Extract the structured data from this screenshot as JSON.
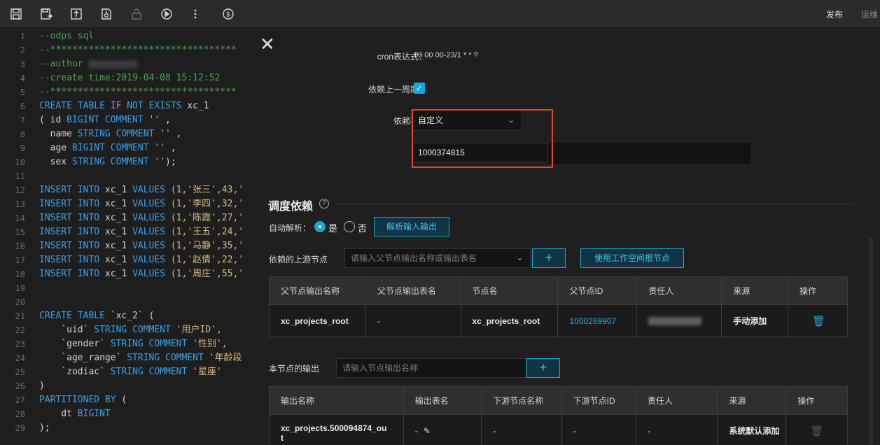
{
  "toolbar": {
    "icons": [
      "save-icon",
      "save-as-icon",
      "submit-icon",
      "schedule-icon",
      "lock-icon",
      "run-icon",
      "more-icon",
      "cost-icon"
    ],
    "publish_label": "发布",
    "ops_label": "运维"
  },
  "editor": {
    "lines": [
      {
        "n": "1"
      },
      {
        "n": "2"
      },
      {
        "n": "3"
      },
      {
        "n": "4"
      },
      {
        "n": "5"
      },
      {
        "n": "6"
      },
      {
        "n": "7"
      },
      {
        "n": "8"
      },
      {
        "n": "9"
      },
      {
        "n": "10"
      },
      {
        "n": "11"
      },
      {
        "n": "12"
      },
      {
        "n": "13"
      },
      {
        "n": "14"
      },
      {
        "n": "15"
      },
      {
        "n": "16"
      },
      {
        "n": "17"
      },
      {
        "n": "18"
      },
      {
        "n": "19"
      },
      {
        "n": "20"
      },
      {
        "n": "21"
      },
      {
        "n": "22"
      },
      {
        "n": "23"
      },
      {
        "n": "24"
      },
      {
        "n": "25"
      },
      {
        "n": "26"
      },
      {
        "n": "27"
      },
      {
        "n": "28"
      },
      {
        "n": "29"
      }
    ],
    "text": {
      "l1": "--odps sql",
      "l2": "--**********************************",
      "l3": "--author",
      "l4": "--create time:2019-04-08 15:12:52",
      "l5": "--**********************************",
      "l6a": "CREATE TABLE ",
      "l6b": "IF",
      "l6c": " NOT EXISTS",
      "l6d": " xc_1",
      "l7a": "( id ",
      "l7b": "BIGINT COMMENT",
      "l7c": " ''",
      "l7d": " ,",
      "l8a": "  name ",
      "l8b": "STRING COMMENT",
      "l8c": " ''",
      "l8d": " ,",
      "l9a": "  age ",
      "l9b": "BIGINT COMMENT",
      "l9c": " ''",
      "l9d": " ,",
      "l10a": "  sex ",
      "l10b": "STRING COMMENT",
      "l10c": " ''",
      "l10d": ");",
      "ins_kw": "INSERT INTO",
      "ins_tbl": " xc_1 ",
      "ins_val": "VALUES",
      "l12": " (1,'张三',43,'",
      "l13": " (1,'李四',32,'",
      "l14": " (1,'陈霞',27,'",
      "l15": " (1,'王五',24,'",
      "l16": " (1,'马静',35,'",
      "l17": " (1,'赵倩',22,'",
      "l18": " (1,'周庄',55,'",
      "l21a": "CREATE TABLE",
      "l21b": " `xc_2` (",
      "l22a": "    `uid` ",
      "l22b": "STRING COMMENT",
      "l22c": " '用户ID',",
      "l23a": "    `gender` ",
      "l23b": "STRING COMMENT",
      "l23c": " '性别',",
      "l24a": "    `age_range` ",
      "l24b": "STRING COMMENT",
      "l24c": " '年龄段",
      "l25a": "    `zodiac` ",
      "l25b": "STRING COMMENT",
      "l25c": " '星座'",
      "l26": ")",
      "l27a": "PARTITIONED BY",
      "l27b": " (",
      "l28a": "    dt ",
      "l28b": "BIGINT",
      "l29": ");"
    }
  },
  "panel": {
    "cron_label": "cron表达式：",
    "cron_value": "00 00 00-23/1 * * ?",
    "depend_prev_label": "依赖上一周期：",
    "depend_item_label": "依赖项：",
    "depend_item_value": "自定义",
    "depend_input_value": "1000374815",
    "schedule_title": "调度依赖",
    "auto_parse_label": "自动解析：",
    "yes_label": "是",
    "no_label": "否",
    "parse_button": "解析输入输出",
    "upstream_label": "依赖的上游节点",
    "upstream_placeholder": "请输入父节点输出名称或输出表名",
    "add_symbol": "+",
    "use_root_button": "使用工作空间根节点",
    "upstream_table": {
      "headers": [
        "父节点输出名称",
        "父节点输出表名",
        "节点名",
        "父节点ID",
        "责任人",
        "来源",
        "操作"
      ],
      "row": {
        "output_name": "xc_projects_root",
        "output_table": "-",
        "node_name": "xc_projects_root",
        "parent_id": "1000269907",
        "source": "手动添加"
      }
    },
    "output_label": "本节点的输出",
    "output_placeholder": "请输入节点输出名称",
    "output_table": {
      "headers": [
        "输出名称",
        "输出表名",
        "下游节点名称",
        "下游节点ID",
        "责任人",
        "来源",
        "操作"
      ],
      "row": {
        "output_name": "xc_projects.500094874_ou",
        "output_name_wrap": "t",
        "output_table": "-",
        "downstream_name": "-",
        "downstream_id": "-",
        "owner": "-",
        "source": "系统默认添加"
      }
    }
  }
}
